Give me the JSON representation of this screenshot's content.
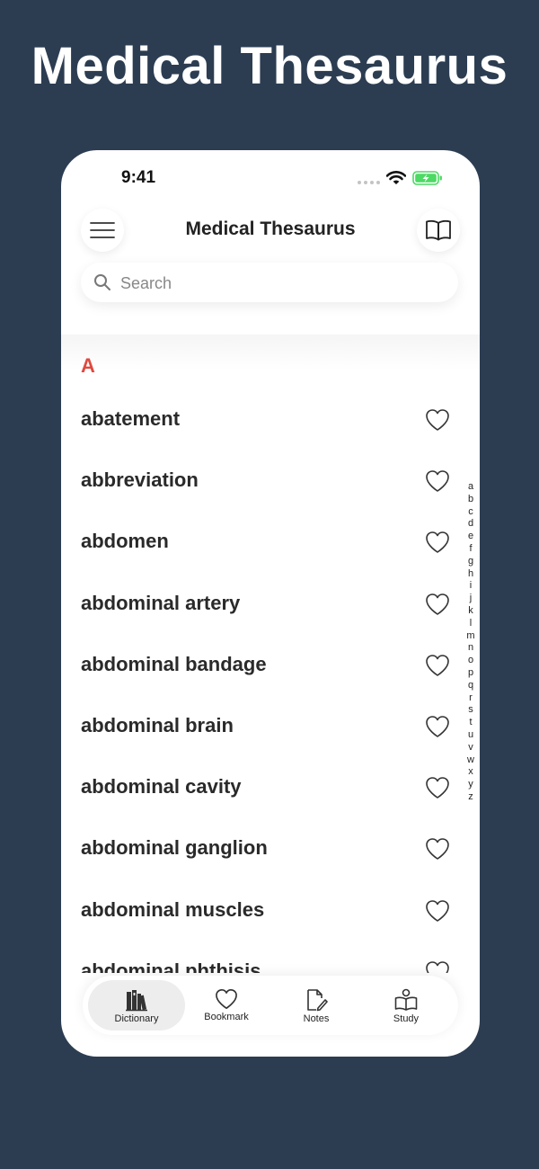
{
  "promo": {
    "title": "Medical Thesaurus"
  },
  "status_bar": {
    "time": "9:41"
  },
  "nav": {
    "title": "Medical Thesaurus"
  },
  "search": {
    "placeholder": "Search"
  },
  "list": {
    "section_letter": "A",
    "words": [
      "abatement",
      "abbreviation",
      "abdomen",
      "abdominal artery",
      "abdominal bandage",
      "abdominal brain",
      "abdominal cavity",
      "abdominal ganglion",
      "abdominal muscles",
      "abdominal phthisis"
    ]
  },
  "alphabet_index": [
    "a",
    "b",
    "c",
    "d",
    "e",
    "f",
    "g",
    "h",
    "i",
    "j",
    "k",
    "l",
    "m",
    "n",
    "o",
    "p",
    "q",
    "r",
    "s",
    "t",
    "u",
    "v",
    "w",
    "x",
    "y",
    "z"
  ],
  "tab_bar": {
    "active": "Dictionary",
    "tabs": [
      {
        "label": "Dictionary",
        "icon": "books-icon"
      },
      {
        "label": "Bookmark",
        "icon": "heart-icon"
      },
      {
        "label": "Notes",
        "icon": "note-edit-icon"
      },
      {
        "label": "Study",
        "icon": "reading-person-icon"
      }
    ]
  },
  "colors": {
    "background": "#2c3d52",
    "accent_letter": "#e0493e",
    "battery": "#4cd964"
  }
}
